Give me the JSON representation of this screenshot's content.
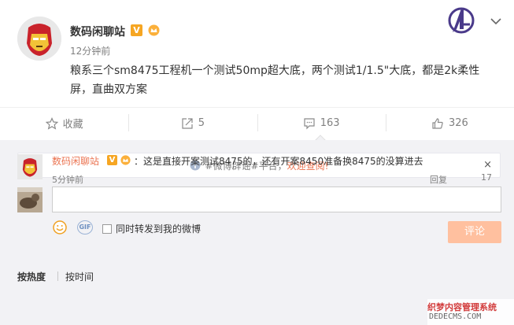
{
  "post": {
    "author": "数码闲聊站",
    "verified_badge": "V",
    "time": "12分钟前",
    "content": "粮系三个sm8475工程机一个测试50mp超大底，两个测试1/1.5\"大底，都是2k柔性屏，直曲双方案"
  },
  "actions": {
    "favorite_label": "收藏",
    "repost_count": "5",
    "comment_count": "163",
    "like_count": "326"
  },
  "notice": {
    "prefix": "#微博辟谣#平台，",
    "highlight": "欢迎查阅!",
    "close": "×"
  },
  "composer": {
    "emoji_icon": "smiley-icon",
    "gif_label": "GIF",
    "repost_label": "同时转发到我的微博",
    "submit_label": "评论"
  },
  "sort": {
    "hot": "按热度",
    "time": "按时间"
  },
  "comment": {
    "author": "数码闲聊站",
    "verified_badge": "V",
    "text": "：这是直接开案测试8475的，还有开案8450准备换8475的没算进去",
    "time": "5分钟前",
    "reply": "回复",
    "likes": "17"
  },
  "watermark": {
    "line1": "织梦内容管理系统",
    "line2": "DEDECMS.COM"
  },
  "colors": {
    "accent": "#eb7350",
    "orange_badge": "#f6a623",
    "submit_disabled": "#ffc09f"
  }
}
